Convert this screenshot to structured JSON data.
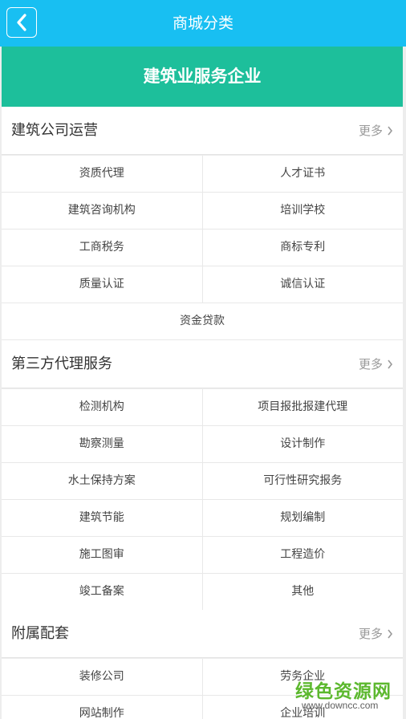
{
  "header": {
    "title": "商城分类"
  },
  "banner": {
    "title": "建筑业服务企业"
  },
  "more_label": "更多",
  "sections": [
    {
      "title": "建筑公司运营",
      "rows": [
        [
          "资质代理",
          "人才证书"
        ],
        [
          "建筑咨询机构",
          "培训学校"
        ],
        [
          "工商税务",
          "商标专利"
        ],
        [
          "质量认证",
          "诚信认证"
        ],
        [
          "资金贷款"
        ]
      ]
    },
    {
      "title": "第三方代理服务",
      "rows": [
        [
          "检测机构",
          "项目报批报建代理"
        ],
        [
          "勘察测量",
          "设计制作"
        ],
        [
          "水土保持方案",
          "可行性研究报务"
        ],
        [
          "建筑节能",
          "规划编制"
        ],
        [
          "施工图审",
          "工程造价"
        ],
        [
          "竣工备案",
          "其他"
        ]
      ]
    },
    {
      "title": "附属配套",
      "rows": [
        [
          "装修公司",
          "劳务企业"
        ],
        [
          "网站制作",
          "企业培训"
        ]
      ]
    }
  ],
  "watermark": {
    "name": "绿色资源网",
    "url": "www.downcc.com"
  }
}
